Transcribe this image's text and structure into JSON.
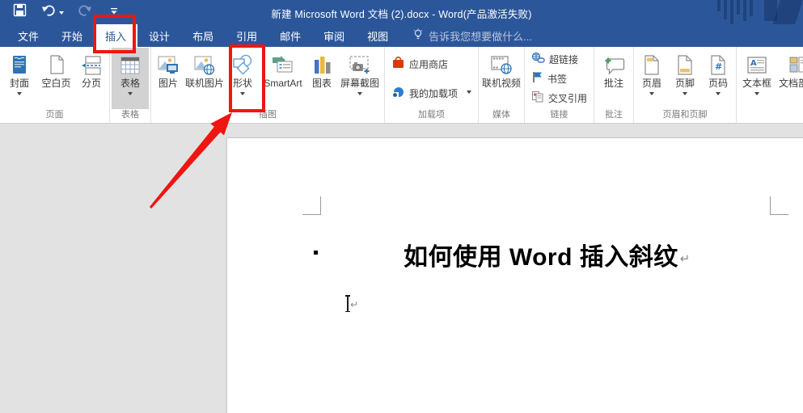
{
  "titlebar": {
    "title": "新建 Microsoft Word 文档 (2).docx - Word(产品激活失败)"
  },
  "tabs": [
    {
      "label": "文件",
      "selected": false
    },
    {
      "label": "开始",
      "selected": false
    },
    {
      "label": "插入",
      "selected": true
    },
    {
      "label": "设计",
      "selected": false
    },
    {
      "label": "布局",
      "selected": false
    },
    {
      "label": "引用",
      "selected": false
    },
    {
      "label": "邮件",
      "selected": false
    },
    {
      "label": "审阅",
      "selected": false
    },
    {
      "label": "视图",
      "selected": false
    }
  ],
  "tellme": {
    "placeholder": "告诉我您想要做什么..."
  },
  "ribbon": {
    "groups": [
      {
        "label": "页面",
        "buttons": [
          {
            "label": "封面",
            "dropdown": true
          },
          {
            "label": "空白页",
            "dropdown": false
          },
          {
            "label": "分页",
            "dropdown": false
          }
        ]
      },
      {
        "label": "表格",
        "buttons": [
          {
            "label": "表格",
            "dropdown": true,
            "highlighted": true
          }
        ]
      },
      {
        "label": "插图",
        "buttons": [
          {
            "label": "图片",
            "dropdown": false
          },
          {
            "label": "联机图片",
            "dropdown": false
          },
          {
            "label": "形状",
            "dropdown": true,
            "annotated": true
          },
          {
            "label": "SmartArt",
            "dropdown": false
          },
          {
            "label": "图表",
            "dropdown": false
          },
          {
            "label": "屏幕截图",
            "dropdown": true
          }
        ]
      },
      {
        "label": "加载项",
        "buttons": [
          {
            "label": "应用商店",
            "dropdown": false
          },
          {
            "label": "我的加载项",
            "dropdown": true
          }
        ]
      },
      {
        "label": "媒体",
        "buttons": [
          {
            "label": "联机视频",
            "dropdown": false
          }
        ]
      },
      {
        "label": "链接",
        "buttons": [
          {
            "label": "超链接",
            "dropdown": false
          },
          {
            "label": "书签",
            "dropdown": false
          },
          {
            "label": "交叉引用",
            "dropdown": false
          }
        ]
      },
      {
        "label": "批注",
        "buttons": [
          {
            "label": "批注",
            "dropdown": false
          }
        ]
      },
      {
        "label": "页眉和页脚",
        "buttons": [
          {
            "label": "页眉",
            "dropdown": true
          },
          {
            "label": "页脚",
            "dropdown": true
          },
          {
            "label": "页码",
            "dropdown": true
          }
        ]
      },
      {
        "label": "",
        "buttons": [
          {
            "label": "文本框",
            "dropdown": true
          },
          {
            "label": "文档部件",
            "dropdown": false
          }
        ]
      }
    ]
  },
  "document": {
    "heading": "如何使用 Word 插入斜纹",
    "paragraph_mark": "↵",
    "cursor_mark": "↵"
  },
  "icons": [
    "save-icon",
    "undo-icon",
    "redo-icon",
    "customize-qat-icon",
    "lightbulb-icon",
    "cover-page-icon",
    "blank-page-icon",
    "page-break-icon",
    "table-icon",
    "picture-icon",
    "online-picture-icon",
    "shapes-icon",
    "smartart-icon",
    "chart-icon",
    "screenshot-icon",
    "store-icon",
    "addins-icon",
    "online-video-icon",
    "hyperlink-icon",
    "bookmark-icon",
    "cross-reference-icon",
    "comment-icon",
    "header-icon",
    "footer-icon",
    "page-number-icon",
    "text-box-icon",
    "quick-parts-icon"
  ],
  "colors": {
    "titlebar_blue": "#2b579a",
    "annotation_red": "#f01511",
    "document_bg": "#e2e2e2",
    "button_highlight": "#d2d2d2"
  }
}
